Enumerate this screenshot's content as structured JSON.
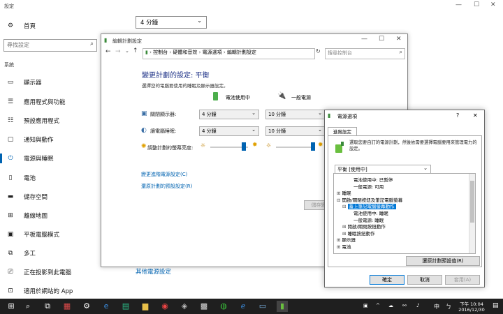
{
  "settings": {
    "window_title": "設定",
    "home_label": "首頁",
    "search_placeholder": "尋找設定",
    "section_label": "系統",
    "items": [
      {
        "label": "顯示器",
        "icon": "monitor-icon"
      },
      {
        "label": "應用程式與功能",
        "icon": "list-icon"
      },
      {
        "label": "預設應用程式",
        "icon": "default-apps-icon"
      },
      {
        "label": "通知與動作",
        "icon": "notification-icon"
      },
      {
        "label": "電源與睡眠",
        "icon": "power-icon"
      },
      {
        "label": "電池",
        "icon": "battery-icon"
      },
      {
        "label": "儲存空間",
        "icon": "storage-icon"
      },
      {
        "label": "離線地圖",
        "icon": "map-icon"
      },
      {
        "label": "平板電腦模式",
        "icon": "tablet-icon"
      },
      {
        "label": "多工",
        "icon": "multitask-icon"
      },
      {
        "label": "正在投影到此電腦",
        "icon": "project-icon"
      },
      {
        "label": "適用於網站的 App",
        "icon": "web-apps-icon"
      }
    ],
    "active_index": 4,
    "sleep_select_value": "4 分鐘",
    "other_power_link": "其他電源設定"
  },
  "control_panel": {
    "title": "編輯計劃設定",
    "breadcrumb": [
      "控制台",
      "硬體和音效",
      "電源選項",
      "編輯計劃設定"
    ],
    "search_placeholder": "搜尋控制台",
    "heading": "變更計劃的設定: 平衡",
    "subheading": "選擇您的電腦要使用的睡眠及顯示器設定。",
    "col_battery": "電池使用中",
    "col_plugged": "一般電源",
    "rows": [
      {
        "label": "關閉顯示器:",
        "battery": "4 分鐘",
        "plugged": "10 分鐘"
      },
      {
        "label": "讓電腦睡眠:",
        "battery": "4 分鐘",
        "plugged": "10 分鐘"
      }
    ],
    "brightness_label": "調整計劃的螢幕亮度:",
    "brightness_battery": 0.88,
    "brightness_plugged": 0.95,
    "link_advanced": "變更進階電源設定(C)",
    "link_restore": "還原計劃的預設設定(R)",
    "save_button": "儲存變"
  },
  "power_options": {
    "title": "電源選項",
    "help": "?",
    "close": "✕",
    "tab": "進階設定",
    "description": "選取您要自訂的電源計劃，然後依需要選擇電腦要用來管理電力的設定。",
    "plan_select": "平衡 [使用中]",
    "tree": [
      {
        "text": "電池使用中: 已暫停",
        "indent": 3,
        "link": ""
      },
      {
        "text": "一般電源: 可用",
        "indent": 3,
        "link": ""
      },
      {
        "text": "睡眠",
        "indent": 0,
        "toggle": "⊞"
      },
      {
        "text": "開啟/關閉按鈕及筆記電腦螢幕",
        "indent": 0,
        "toggle": "⊟"
      },
      {
        "text": "蓋上筆記電腦螢幕動作",
        "indent": 1,
        "toggle": "⊟",
        "selected": true
      },
      {
        "text": "電池使用中: 睡眠",
        "indent": 3
      },
      {
        "text": "一般電源: 睡眠",
        "indent": 3
      },
      {
        "text": "開啟/關閉按鈕動作",
        "indent": 1,
        "toggle": "⊞"
      },
      {
        "text": "睡眠按鈕動作",
        "indent": 1,
        "toggle": "⊞"
      },
      {
        "text": "顯示器",
        "indent": 0,
        "toggle": "⊞"
      },
      {
        "text": "電池",
        "indent": 0,
        "toggle": "⊞"
      }
    ],
    "restore_button": "還原計劃預設值(R)",
    "ok_button": "確定",
    "cancel_button": "取消",
    "apply_button": "套用(A)"
  },
  "taskbar": {
    "time": "下午 10:04",
    "date": "2016/12/30",
    "ime": "中",
    "ime2": "ㄅ"
  },
  "colors": {
    "accent": "#0063b1",
    "heading": "#1e3287",
    "taskbar": "#1f1f1f"
  }
}
